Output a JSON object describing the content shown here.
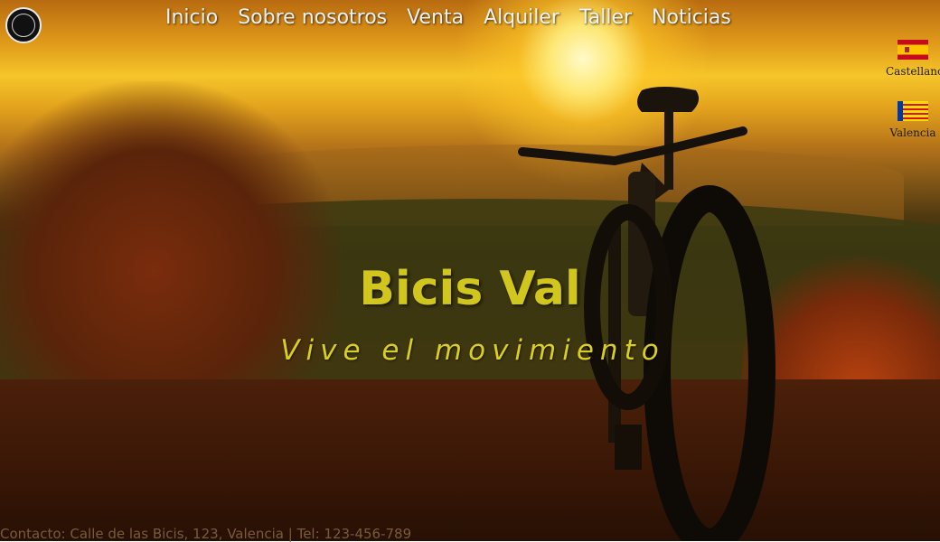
{
  "brand": {
    "logo_icon": "bicis-val-logo-icon"
  },
  "nav": {
    "items": [
      {
        "label": "Inicio"
      },
      {
        "label": "Sobre nosotros"
      },
      {
        "label": "Venta"
      },
      {
        "label": "Alquiler"
      },
      {
        "label": "Taller"
      },
      {
        "label": "Noticias"
      }
    ]
  },
  "languages": [
    {
      "label": "Castellano",
      "icon": "spain-flag-icon"
    },
    {
      "label": "Valencia",
      "icon": "valencian-flag-icon"
    }
  ],
  "hero": {
    "title": "Bicis Val",
    "subtitle": "Vive el movimiento",
    "background_image": "mountain-bike-sunset-photo"
  },
  "footer": {
    "contact": "Contacto: Calle de las Bicis, 123, Valencia | Tel: 123-456-789"
  },
  "colors": {
    "title": "#d1c61d",
    "nav_text": "#f1f1f1"
  }
}
